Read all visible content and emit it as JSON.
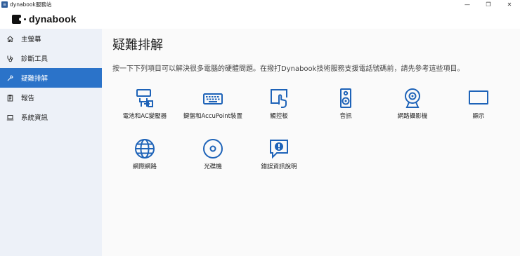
{
  "window": {
    "title": "dynabook服務站",
    "app_icon_glyph": "≡",
    "controls": {
      "minimize": "—",
      "restore": "❐",
      "close": "✕"
    }
  },
  "brand": {
    "logo_text": "dynabook"
  },
  "sidebar": {
    "items": [
      {
        "label": "主螢幕",
        "icon": "home-icon"
      },
      {
        "label": "診斷工具",
        "icon": "stethoscope-icon"
      },
      {
        "label": "疑難排解",
        "icon": "wrench-icon",
        "active": true
      },
      {
        "label": "報告",
        "icon": "clipboard-icon"
      },
      {
        "label": "系統資訊",
        "icon": "laptop-icon"
      }
    ]
  },
  "main": {
    "title": "疑難排解",
    "description": "按一下下列項目可以解決很多電腦的硬體問題。在撥打Dynabook技術服務支援電話號碼前，請先參考這些項目。",
    "tiles": [
      {
        "label": "電池和AC變壓器",
        "icon": "battery-adapter-icon"
      },
      {
        "label": "鍵盤和AccuPoint裝置",
        "icon": "keyboard-icon"
      },
      {
        "label": "觸控板",
        "icon": "touchpad-icon"
      },
      {
        "label": "音訊",
        "icon": "speaker-icon"
      },
      {
        "label": "網路攝影機",
        "icon": "webcam-icon"
      },
      {
        "label": "顯示",
        "icon": "display-icon"
      },
      {
        "label": "網際網路",
        "icon": "globe-icon"
      },
      {
        "label": "光碟機",
        "icon": "optical-disc-icon"
      },
      {
        "label": "錯誤資訊說明",
        "icon": "error-message-icon"
      }
    ]
  },
  "colors": {
    "accent": "#2b73c9",
    "icon_blue": "#1e63b8",
    "sidebar_bg": "#edf1f8",
    "content_bg": "#fafafa"
  }
}
